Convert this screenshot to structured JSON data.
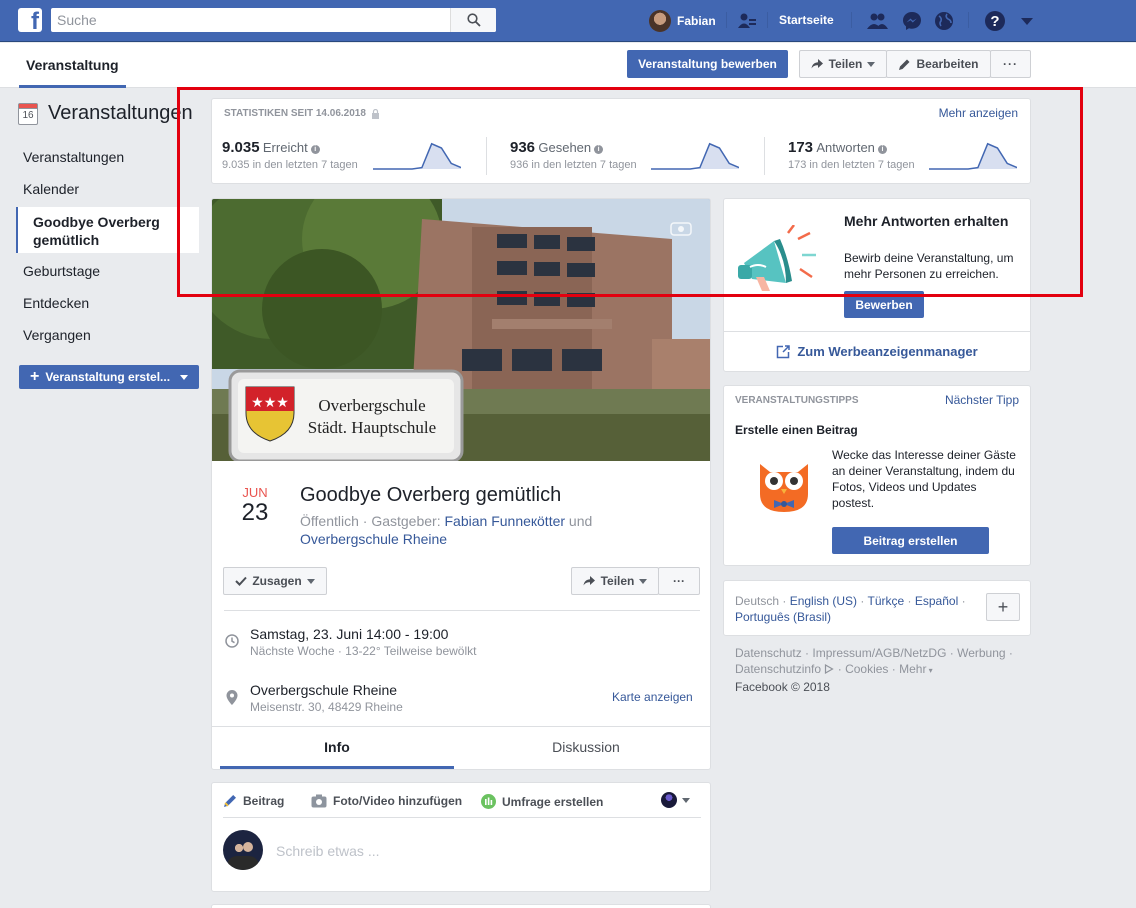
{
  "topbar": {
    "logo": "f",
    "search_placeholder": "Suche",
    "user_name": "Fabian",
    "home_label": "Startseite",
    "icons": [
      "search-icon",
      "friend-finder-icon",
      "friends-icon",
      "messenger-icon",
      "globe-icon",
      "help-icon",
      "dropdown-icon"
    ]
  },
  "subheader": {
    "tab_label": "Veranstaltung",
    "promote_button": "Veranstaltung bewerben",
    "share_button": "Teilen",
    "edit_button": "Bearbeiten",
    "more_button": "···"
  },
  "sidebar": {
    "title": "Veranstaltungen",
    "calendar_day": "16",
    "items": [
      {
        "label": "Veranstaltungen"
      },
      {
        "label": "Kalender"
      },
      {
        "label": "Goodbye Overberg gemütlich",
        "active": true
      },
      {
        "label": "Geburtstage"
      },
      {
        "label": "Entdecken"
      },
      {
        "label": "Vergangen"
      }
    ],
    "create_button": "Veranstaltung erstel..."
  },
  "stats": {
    "header": "STATISTIKEN SEIT 14.06.2018",
    "more_link": "Mehr anzeigen",
    "items": [
      {
        "value": "9.035",
        "label": "Erreicht",
        "sub": "9.035 in den letzten 7 tagen"
      },
      {
        "value": "936",
        "label": "Gesehen",
        "sub": "936 in den letzten 7 tagen"
      },
      {
        "value": "173",
        "label": "Antworten",
        "sub": "173 in den letzten 7 tagen"
      }
    ],
    "sparkline_accent": "#4267b2"
  },
  "cover": {
    "sign_line1": "Overbergschule",
    "sign_line2": "Städt. Hauptschule",
    "stars": "★★★"
  },
  "event": {
    "month": "JUN",
    "day": "23",
    "title": "Goodbye Overberg gemütlich",
    "privacy": "Öffentlich",
    "host_prefix": "· Gastgeber:",
    "host1": "Fabian Funneкötter",
    "host_conj": "und",
    "host2": "Overbergschule Rheine",
    "going_button": "Zusagen",
    "share_button": "Teilen",
    "more_button": "···",
    "datetime": "Samstag, 23. Juni 14:00 - 19:00",
    "datetime_sub": "Nächste Woche · 13-22° Teilweise bewölkt",
    "location": "Overbergschule Rheine",
    "address": "Meisenstr. 30, 48429 Rheine",
    "map_link": "Karte anzeigen",
    "tab_info": "Info",
    "tab_discussion": "Diskussion"
  },
  "composer": {
    "post_tab": "Beitrag",
    "photo_tab": "Foto/Video hinzufügen",
    "poll_tab": "Umfrage erstellen",
    "placeholder": "Schreib etwas ..."
  },
  "promo": {
    "title": "Mehr Antworten erhalten",
    "text": "Bewirb deine Veranstaltung, um mehr Personen zu erreichen.",
    "button": "Bewerben",
    "ads_manager_link": "Zum Werbeanzeigenmanager"
  },
  "tips": {
    "header": "VERANSTALTUNGSTIPPS",
    "next_link": "Nächster Tipp",
    "title": "Erstelle einen Beitrag",
    "text": "Wecke das Interesse deiner Gäste an deiner Veranstaltung, indem du Fotos, Videos und Updates postest.",
    "button": "Beitrag erstellen"
  },
  "languages": {
    "current": "Deutsch",
    "others": [
      "English (US)",
      "Türkçe",
      "Español",
      "Português (Brasil)"
    ],
    "add_button": "+"
  },
  "footer": {
    "links": [
      "Datenschutz",
      "Impressum/AGB/NetzDG",
      "Werbung",
      "Datenschutzinfo",
      "Cookies",
      "Mehr"
    ],
    "copyright": "Facebook © 2018"
  }
}
